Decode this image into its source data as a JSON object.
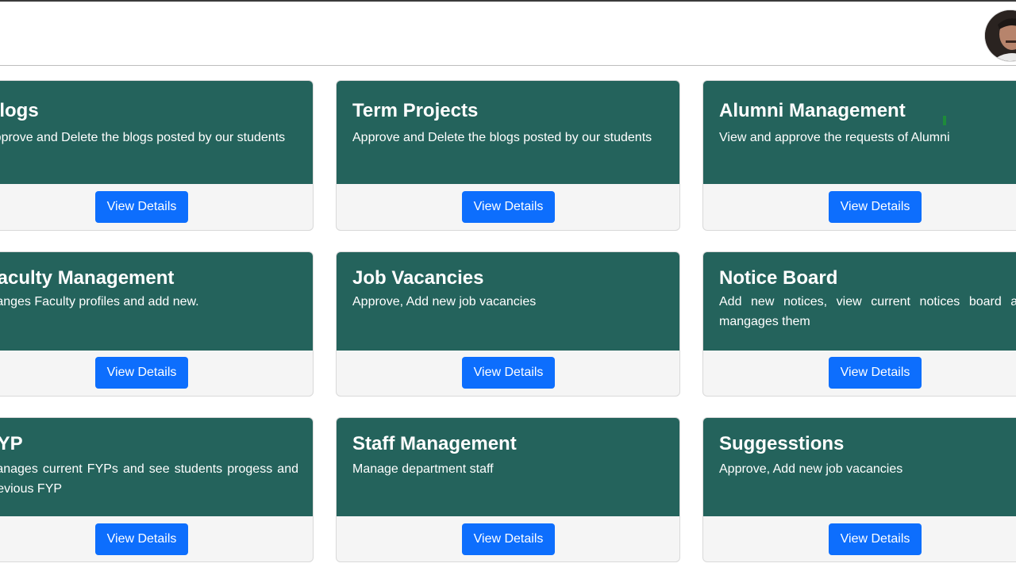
{
  "header": {
    "avatar_alt": "profile-avatar"
  },
  "cards": [
    {
      "title": "Blogs",
      "text": "Approve and Delete the blogs posted by our students",
      "button": "View Details"
    },
    {
      "title": "Term Projects",
      "text": "Approve and Delete the blogs posted by our students",
      "button": "View Details"
    },
    {
      "title": "Alumni Management",
      "text": "View and approve the requests of Alumni",
      "button": "View Details"
    },
    {
      "title": "Faculty Management",
      "text": "Manges Faculty profiles and add new.",
      "button": "View Details"
    },
    {
      "title": "Job Vacancies",
      "text": "Approve, Add new job vacancies",
      "button": "View Details"
    },
    {
      "title": "Notice Board",
      "text": "Add new notices, view current notices board and mangages them",
      "button": "View Details"
    },
    {
      "title": "FYP",
      "text": "Manages current FYPs and see students progess and previous FYP",
      "button": "View Details"
    },
    {
      "title": "Staff Management",
      "text": "Manage department staff",
      "button": "View Details"
    },
    {
      "title": "Suggesstions",
      "text": "Approve, Add new job vacancies",
      "button": "View Details"
    }
  ],
  "colors": {
    "card_header": "#24635c",
    "button": "#0d6efd",
    "card_body": "#f5f5f5"
  }
}
